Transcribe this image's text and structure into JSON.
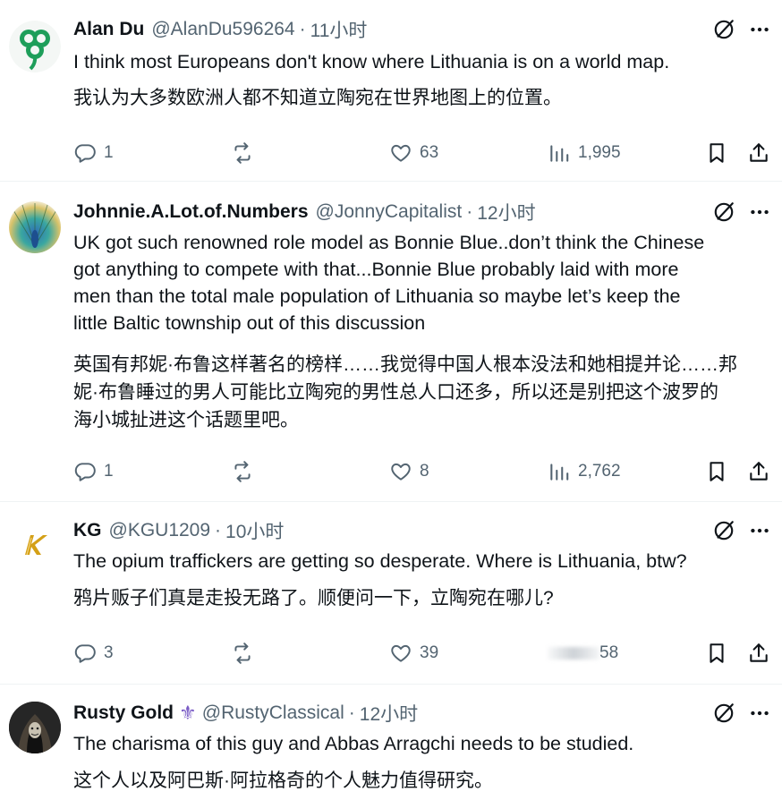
{
  "posts": [
    {
      "name": "Alan Du",
      "handle": "@AlanDu596264",
      "time": "11小时",
      "text_en": "I think most Europeans don't know where Lithuania is on a world map.",
      "text_zh": "我认为大多数欧洲人都不知道立陶宛在世界地图上的位置。",
      "replies": "1",
      "reposts": "",
      "likes": "63",
      "views": "1,995",
      "avatar": "shamrock-avatar"
    },
    {
      "name": "Johnnie.A.Lot.of.Numbers",
      "handle": "@JonnyCapitalist",
      "time": "12小时",
      "text_en_lines": [
        "UK got such renowned role model as Bonnie Blue..don’t think the Chinese",
        "got anything to compete with that...Bonnie Blue probably laid with more",
        "men than the total male population of Lithuania so maybe let’s keep the",
        "little Baltic township out of this discussion"
      ],
      "text_zh_lines": [
        "英国有邦妮·布鲁这样著名的榜样……我觉得中国人根本没法和她相提并论……邦",
        "妮·布鲁睡过的男人可能比立陶宛的男性总人口还多，所以还是别把这个波罗的",
        "海小城扯进这个话题里吧。"
      ],
      "replies": "1",
      "reposts": "",
      "likes": "8",
      "views": "2,762",
      "avatar": "peacock-avatar"
    },
    {
      "name": "KG",
      "handle": "@KGU1209",
      "time": "10小时",
      "text_en": "The opium traffickers are getting so desperate. Where is Lithuania, btw?",
      "text_zh": "鸦片贩子们真是走投无路了。顺便问一下，立陶宛在哪儿?",
      "replies": "3",
      "reposts": "",
      "likes": "39",
      "views": "58",
      "avatar": "gold-k-logo-avatar"
    },
    {
      "name": "Rusty Gold",
      "name_emoji": "⚜",
      "handle": "@RustyClassical",
      "time": "12小时",
      "text_en": "The charisma of this guy and Abbas Arragchi needs to be studied.",
      "text_zh": "这个人以及阿巴斯·阿拉格奇的个人魅力值得研究。",
      "avatar": "hooded-figure-avatar"
    }
  ],
  "separator": "·",
  "colors": {
    "text": "#0f1419",
    "muted": "#536471",
    "divider": "#eff3f4",
    "shamrock": "#1e9e5a",
    "fleur": "#7a5cc6",
    "kgold": "#d4a017"
  }
}
